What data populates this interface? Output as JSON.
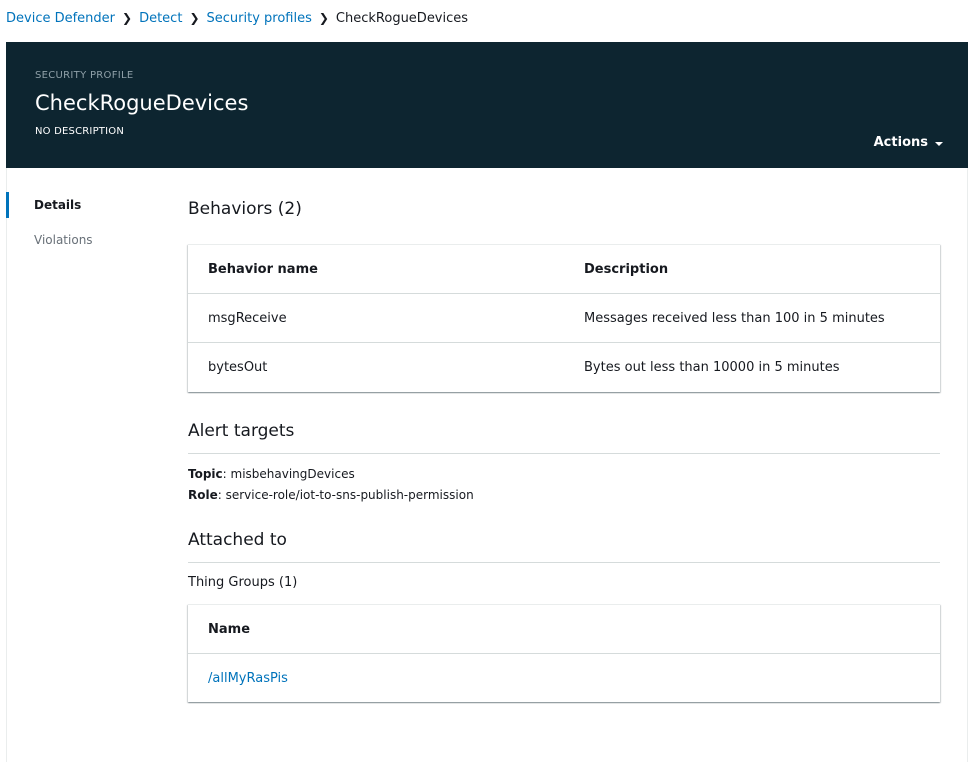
{
  "breadcrumb": {
    "items": [
      "Device Defender",
      "Detect",
      "Security profiles"
    ],
    "current": "CheckRogueDevices"
  },
  "header": {
    "overline": "SECURITY PROFILE",
    "title": "CheckRogueDevices",
    "description": "NO DESCRIPTION",
    "actions_label": "Actions"
  },
  "sidenav": {
    "items": [
      {
        "label": "Details",
        "active": true
      },
      {
        "label": "Violations",
        "active": false
      }
    ]
  },
  "behaviors": {
    "title": "Behaviors (2)",
    "columns": [
      "Behavior name",
      "Description"
    ],
    "rows": [
      {
        "name": "msgReceive",
        "description": "Messages received less than 100 in 5 minutes"
      },
      {
        "name": "bytesOut",
        "description": "Bytes out less than 10000 in 5 minutes"
      }
    ]
  },
  "alert_targets": {
    "title": "Alert targets",
    "topic_key": "Topic",
    "topic_value": ": misbehavingDevices",
    "role_key": "Role",
    "role_value": ": service-role/iot-to-sns-publish-permission"
  },
  "attached_to": {
    "title": "Attached to",
    "groups_label": "Thing Groups (1)",
    "column": "Name",
    "rows": [
      "/allMyRasPis"
    ]
  },
  "colors": {
    "header_bg": "#0d2530",
    "link": "#0073bb",
    "accent": "#0073bb"
  }
}
